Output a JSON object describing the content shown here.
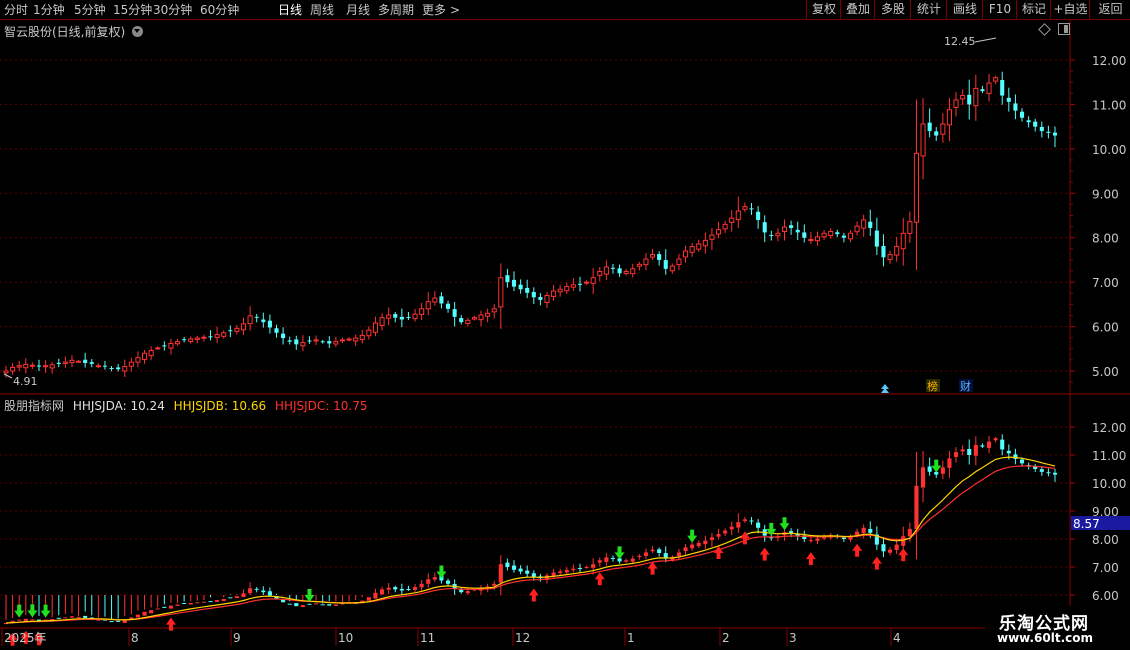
{
  "toolbar": {
    "periods": [
      "分时",
      "1分钟",
      "5分钟",
      "15分钟",
      "30分钟",
      "60分钟",
      "日线",
      "周线",
      "月线",
      "多周期",
      "更多"
    ],
    "more_arrow": ">",
    "right_buttons": [
      "复权",
      "叠加",
      "多股",
      "统计",
      "画线",
      "F10",
      "标记",
      "+自选",
      "返回"
    ]
  },
  "main_panel": {
    "title": "智云股份(日线,前复权)",
    "price_ticks": [
      "12.00",
      "11.00",
      "10.00",
      "9.00",
      "8.00",
      "7.00",
      "6.00",
      "5.00"
    ],
    "high_label": "12.45",
    "low_label": "4.91",
    "markers": [
      "榜",
      "财"
    ]
  },
  "indicator_panel": {
    "name": "股朋指标网",
    "lines": [
      {
        "text": "HHJSJDA: 10.24",
        "color": "#e0e0e0"
      },
      {
        "text": "HHJSJDB: 10.66",
        "color": "#ffd400"
      },
      {
        "text": "HHJSJDC: 10.75",
        "color": "#ff3030"
      }
    ],
    "ticks": [
      "12.00",
      "11.00",
      "10.00",
      "9.00",
      "8.00",
      "7.00",
      "6.00"
    ],
    "current_value": "8.57"
  },
  "time_axis": [
    "2025年",
    "8",
    "9",
    "10",
    "11",
    "12",
    "1",
    "2",
    "3",
    "4"
  ],
  "watermark": {
    "line1": "乐淘公式网",
    "line2": "www.60lt.com"
  },
  "chart_data": {
    "type": "candlestick",
    "title": "智云股份(日线,前复权)",
    "period": "daily",
    "date_range": [
      "2025-07",
      "2026-04"
    ],
    "month_labels": [
      "2025年",
      "8",
      "9",
      "10",
      "11",
      "12",
      "1",
      "2",
      "3",
      "4"
    ],
    "ylim": [
      4.7,
      12.7
    ],
    "high": 12.45,
    "low": 4.91,
    "close_series_approx": [
      5.0,
      5.08,
      5.12,
      5.15,
      5.13,
      5.1,
      5.12,
      5.14,
      5.16,
      5.2,
      5.24,
      5.22,
      5.18,
      5.16,
      5.12,
      5.1,
      5.06,
      5.04,
      5.1,
      5.2,
      5.3,
      5.4,
      5.46,
      5.52,
      5.56,
      5.62,
      5.66,
      5.7,
      5.72,
      5.74,
      5.76,
      5.78,
      5.82,
      5.86,
      5.9,
      5.96,
      6.06,
      6.24,
      6.2,
      6.1,
      5.98,
      5.86,
      5.74,
      5.66,
      5.6,
      5.64,
      5.68,
      5.7,
      5.66,
      5.62,
      5.66,
      5.7,
      5.72,
      5.74,
      5.8,
      5.92,
      6.08,
      6.2,
      6.26,
      6.2,
      6.16,
      6.2,
      6.28,
      6.4,
      6.56,
      6.64,
      6.52,
      6.4,
      6.22,
      6.1,
      6.14,
      6.2,
      6.26,
      6.3,
      6.4,
      7.1,
      7.0,
      6.9,
      6.84,
      6.76,
      6.66,
      6.6,
      6.7,
      6.8,
      6.84,
      6.9,
      6.94,
      6.96,
      7.0,
      7.1,
      7.24,
      7.34,
      7.3,
      7.2,
      7.24,
      7.3,
      7.4,
      7.52,
      7.62,
      7.5,
      7.3,
      7.36,
      7.52,
      7.7,
      7.8,
      7.86,
      7.94,
      8.06,
      8.18,
      8.3,
      8.44,
      8.6,
      8.7,
      8.64,
      8.4,
      8.12,
      8.04,
      8.1,
      8.24,
      8.22,
      8.12,
      8.0,
      7.96,
      8.02,
      8.1,
      8.14,
      8.08,
      8.0,
      8.1,
      8.26,
      8.4,
      8.22,
      7.8,
      7.56,
      7.62,
      7.8,
      8.1,
      8.36,
      9.9,
      10.56,
      10.4,
      10.3,
      10.56,
      10.88,
      11.1,
      11.2,
      11.0,
      11.36,
      11.3,
      11.48,
      11.6,
      11.2,
      11.06,
      10.86,
      10.7,
      10.6,
      10.5,
      10.4,
      10.36,
      10.3
    ],
    "indicator_series": [
      {
        "name": "HHJSJDA",
        "last": 10.24,
        "color": "#e0e0e0"
      },
      {
        "name": "HHJSJDB",
        "last": 10.66,
        "color": "#ffd400"
      },
      {
        "name": "HHJSJDC",
        "last": 10.75,
        "color": "#ff3030"
      }
    ],
    "indicator_ylim": [
      5.9,
      12.6
    ],
    "indicator_current": 8.57,
    "buy_signal_indices": [
      1,
      3,
      5,
      25,
      80,
      90,
      98,
      108,
      112,
      115,
      122,
      129,
      132,
      136
    ],
    "sell_signal_indices": [
      2,
      4,
      6,
      46,
      66,
      93,
      104,
      116,
      118,
      141
    ]
  }
}
